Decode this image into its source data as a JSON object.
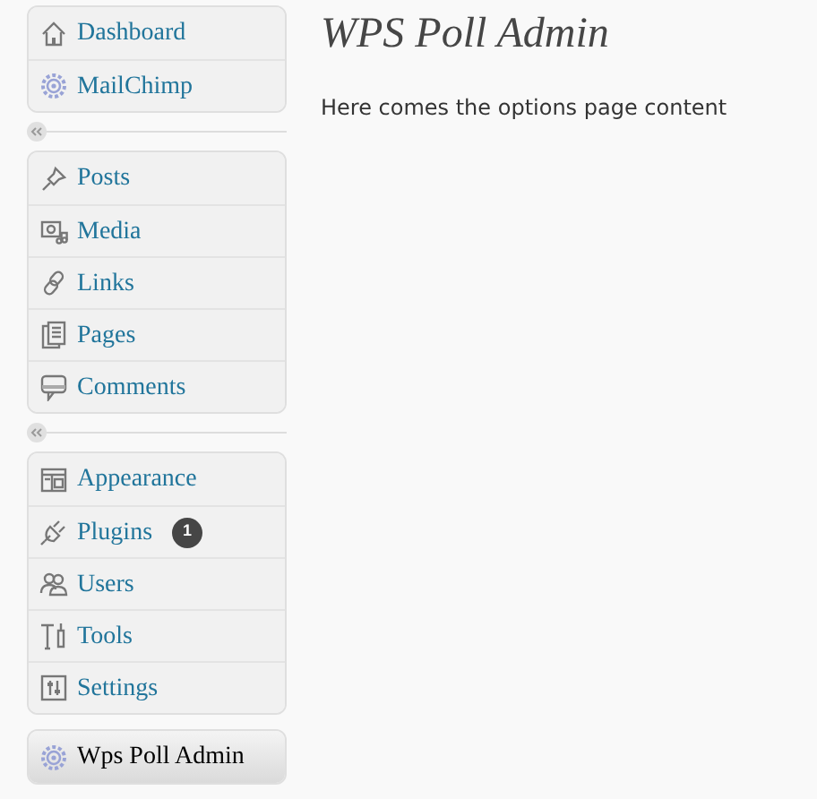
{
  "menu": [
    {
      "kind": "group",
      "items": [
        {
          "label": "Dashboard",
          "selected": false
        },
        {
          "label": "MailChimp",
          "selected": false
        }
      ]
    },
    {
      "kind": "separator"
    },
    {
      "kind": "group",
      "items": [
        {
          "label": "Posts",
          "selected": false
        },
        {
          "label": "Media",
          "selected": false
        },
        {
          "label": "Links",
          "selected": false
        },
        {
          "label": "Pages",
          "selected": false
        },
        {
          "label": "Comments",
          "selected": false
        }
      ]
    },
    {
      "kind": "separator"
    },
    {
      "kind": "group",
      "items": [
        {
          "label": "Appearance",
          "selected": false
        },
        {
          "label": "Plugins",
          "selected": false,
          "badge": "1"
        },
        {
          "label": "Users",
          "selected": false
        },
        {
          "label": "Tools",
          "selected": false
        },
        {
          "label": "Settings",
          "selected": false
        }
      ]
    },
    {
      "kind": "group",
      "items": [
        {
          "label": "Wps Poll Admin",
          "selected": true
        }
      ]
    }
  ],
  "page": {
    "title": "WPS Poll Admin",
    "body": "Here comes the options page content"
  }
}
